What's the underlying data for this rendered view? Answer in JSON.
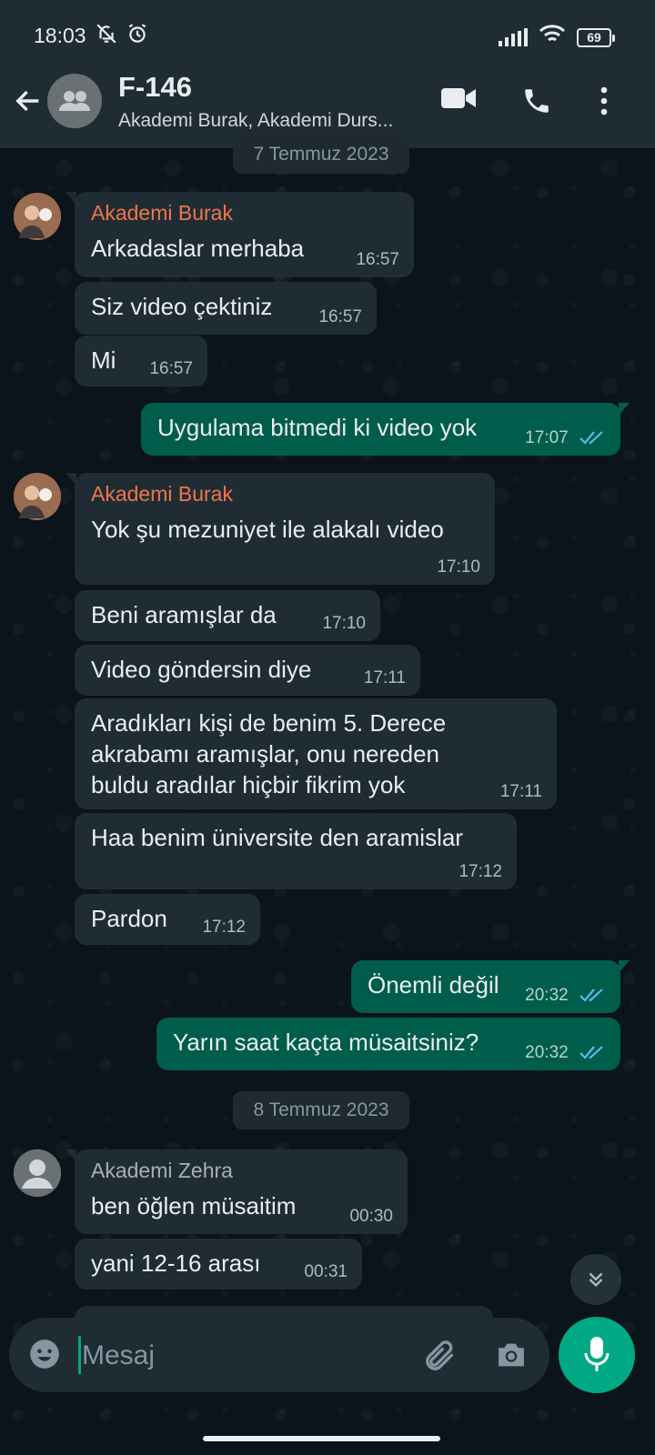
{
  "status_bar": {
    "time": "18:03",
    "battery": "69"
  },
  "header": {
    "title": "F-146",
    "subtitle": "Akademi Burak, Akademi Durs..."
  },
  "dates": [
    "7 Temmuz 2023",
    "8 Temmuz 2023"
  ],
  "messages": [
    {
      "dir": "in",
      "sender": "Akademi Burak",
      "text": "Arkadaslar merhaba",
      "time": "16:57"
    },
    {
      "dir": "in",
      "text": "Siz video çektiniz",
      "time": "16:57"
    },
    {
      "dir": "in",
      "text": "Mi",
      "time": "16:57"
    },
    {
      "dir": "out",
      "text": "Uygulama bitmedi ki video yok",
      "time": "17:07",
      "status": "read"
    },
    {
      "dir": "in",
      "sender": "Akademi Burak",
      "text": "Yok şu mezuniyet ile alakalı video",
      "time": "17:10"
    },
    {
      "dir": "in",
      "text": "Beni aramışlar da",
      "time": "17:10"
    },
    {
      "dir": "in",
      "text": "Video göndersin diye",
      "time": "17:11"
    },
    {
      "dir": "in",
      "lines": [
        "Aradıkları kişi de benim 5. Derece",
        "akrabamı aramışlar, onu nereden",
        "buldu aradılar hiçbir fikrim yok"
      ],
      "time": "17:11"
    },
    {
      "dir": "in",
      "text": "Haa benim üniversite den aramislar",
      "time": "17:12"
    },
    {
      "dir": "in",
      "text": "Pardon",
      "time": "17:12"
    },
    {
      "dir": "out",
      "text": "Önemli değil",
      "time": "20:32",
      "status": "read"
    },
    {
      "dir": "out",
      "text": "Yarın saat kaçta müsaitsiniz?",
      "time": "20:32",
      "status": "read"
    },
    {
      "dir": "in",
      "sender": "Akademi Zehra",
      "text": "ben öğlen müsaitim",
      "time": "00:30"
    },
    {
      "dir": "in",
      "text": "yani 12-16 arası",
      "time": "00:31"
    }
  ],
  "composer": {
    "placeholder": "Mesaj"
  },
  "colors": {
    "background": "#0b141a",
    "header": "#1f2c34",
    "incoming_bubble": "#202c33",
    "outgoing_bubble": "#005c4b",
    "accent": "#00a884",
    "sender_name": "#f0744b",
    "read_ticks": "#53bdeb"
  },
  "icons": [
    "back-arrow-icon",
    "group-icon",
    "video-call-icon",
    "phone-icon",
    "more-vert-icon",
    "emoji-icon",
    "attach-icon",
    "camera-icon",
    "mic-icon",
    "double-chevron-down-icon",
    "bell-off-icon",
    "alarm-icon",
    "signal-icon",
    "wifi-icon"
  ]
}
